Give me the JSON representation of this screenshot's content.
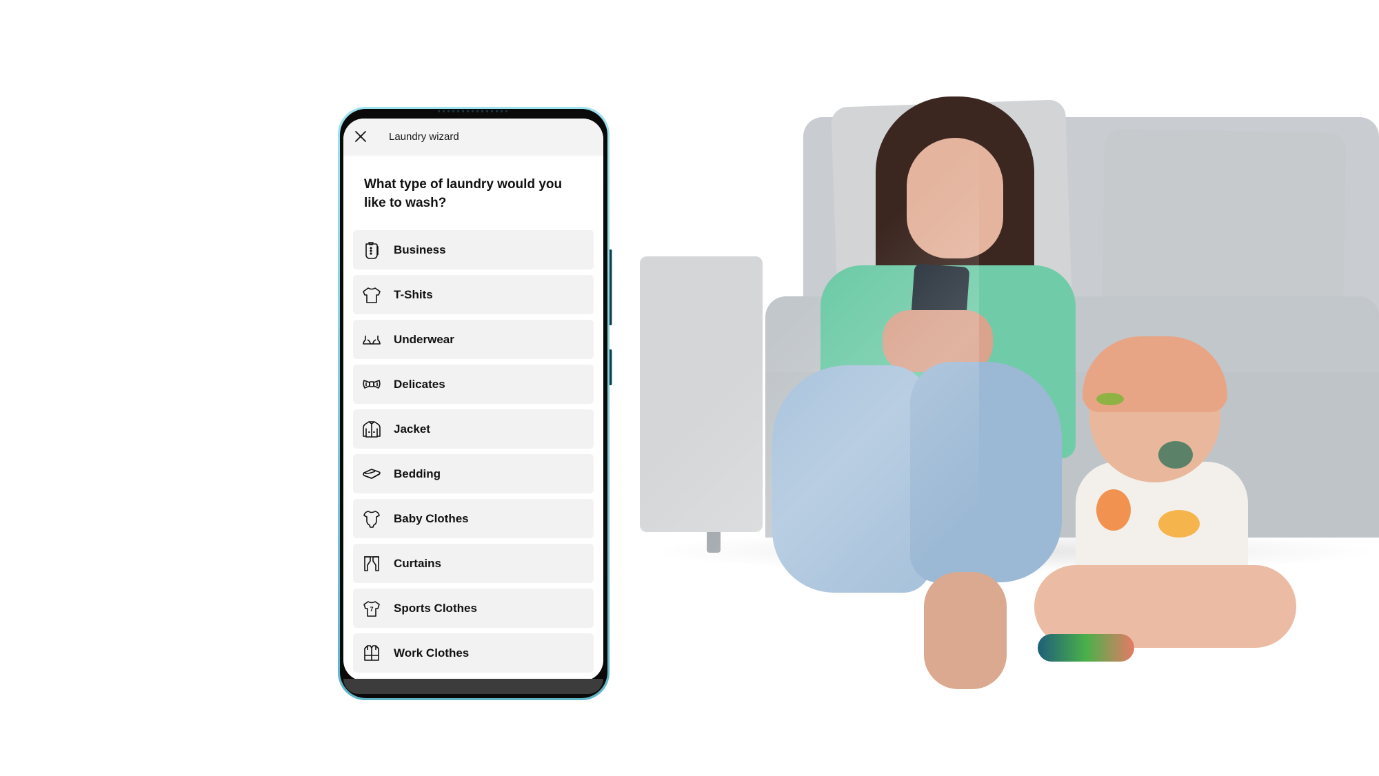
{
  "app": {
    "header_title": "Laundry wizard",
    "close_icon": "close-icon",
    "question": "What type of laundry would you like to wash?"
  },
  "options": [
    {
      "label": "Business",
      "icon": "business-shirt-icon"
    },
    {
      "label": "T-Shits",
      "icon": "tshirt-icon"
    },
    {
      "label": "Underwear",
      "icon": "bra-icon"
    },
    {
      "label": "Delicates",
      "icon": "bow-icon"
    },
    {
      "label": "Jacket",
      "icon": "jacket-icon"
    },
    {
      "label": "Bedding",
      "icon": "bedding-icon"
    },
    {
      "label": "Baby Clothes",
      "icon": "baby-bodysuit-icon"
    },
    {
      "label": "Curtains",
      "icon": "curtains-icon"
    },
    {
      "label": "Sports Clothes",
      "icon": "sports-jersey-icon"
    },
    {
      "label": "Work Clothes",
      "icon": "work-vest-icon"
    }
  ],
  "colors": {
    "phone_frame": "#5fb5c8",
    "header_bg": "#f3f3f3",
    "option_bg": "#f2f2f2",
    "text": "#111111"
  },
  "photo": {
    "description": "Woman sitting on floor in front of a grey sofa using a smartphone, toddler covered in paint beside her"
  }
}
